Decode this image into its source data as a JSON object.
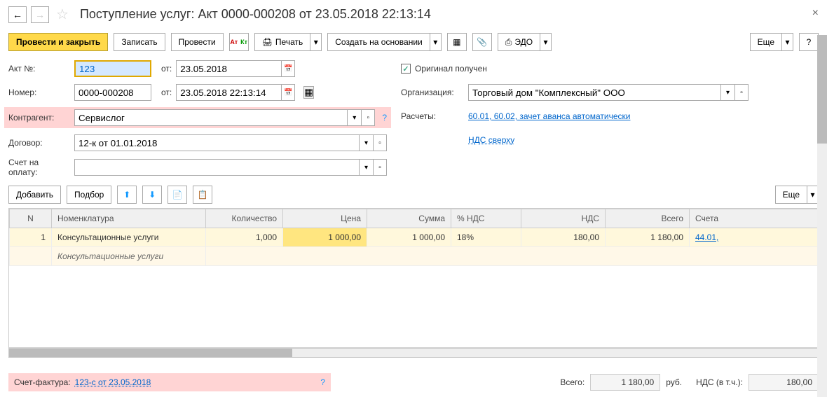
{
  "title": "Поступление услуг: Акт 0000-000208 от 23.05.2018 22:13:14",
  "toolbar": {
    "submit_close": "Провести и закрыть",
    "save": "Записать",
    "submit": "Провести",
    "print": "Печать",
    "create_based": "Создать на основании",
    "edo": "ЭДО",
    "more": "Еще"
  },
  "form": {
    "act_no_label": "Акт №:",
    "act_no": "123",
    "from_label": "от:",
    "act_date": "23.05.2018",
    "number_label": "Номер:",
    "number": "0000-000208",
    "number_date": "23.05.2018 22:13:14",
    "contragent_label": "Контрагент:",
    "contragent": "Сервислог",
    "contract_label": "Договор:",
    "contract": "12-к от 01.01.2018",
    "invoice_pay_label": "Счет на оплату:",
    "original_received": "Оригинал получен",
    "org_label": "Организация:",
    "org": "Торговый дом \"Комплексный\" ООО",
    "calc_label": "Расчеты:",
    "calc_link": "60.01, 60.02, зачет аванса автоматически",
    "vat_link": "НДС сверху"
  },
  "table_toolbar": {
    "add": "Добавить",
    "pick": "Подбор",
    "more": "Еще"
  },
  "table": {
    "headers": {
      "n": "N",
      "nomenclature": "Номенклатура",
      "qty": "Количество",
      "price": "Цена",
      "sum": "Сумма",
      "vat_pct": "% НДС",
      "vat": "НДС",
      "total": "Всего",
      "accounts": "Счета"
    },
    "rows": [
      {
        "n": "1",
        "name": "Консультационные услуги",
        "desc": "Консультационные услуги",
        "qty": "1,000",
        "price": "1 000,00",
        "sum": "1 000,00",
        "vat_pct": "18%",
        "vat": "180,00",
        "total": "1 180,00",
        "acct": "44.01,"
      }
    ]
  },
  "footer": {
    "invoice_label": "Счет-фактура:",
    "invoice_link": "123-с от 23.05.2018",
    "total_label": "Всего:",
    "total": "1 180,00",
    "currency": "руб.",
    "vat_label": "НДС (в т.ч.):",
    "vat": "180,00"
  }
}
